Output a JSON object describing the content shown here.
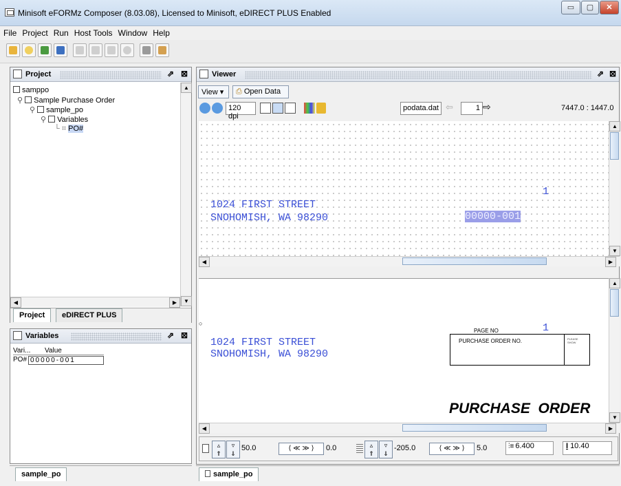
{
  "window": {
    "title": "Minisoft eFORMz Composer (8.03.08), Licensed to Minisoft, eDIRECT PLUS Enabled",
    "min_symbol": "▭",
    "max_symbol": "▢",
    "close_symbol": "✕"
  },
  "menu": [
    "File",
    "Project",
    "Run",
    "Host Tools",
    "Window",
    "Help"
  ],
  "project_panel": {
    "title": "Project",
    "tree": [
      {
        "label": "samppo",
        "icon": "printer-icon"
      },
      {
        "label": "Sample Purchase Order",
        "icon": "document-icon"
      },
      {
        "label": "sample_po",
        "icon": "form-icon"
      },
      {
        "label": "Variables",
        "icon": "variables-icon"
      },
      {
        "label": "PO#",
        "icon": "variable-icon"
      }
    ],
    "tabs": [
      "Project",
      "eDIRECT PLUS"
    ]
  },
  "variables_panel": {
    "title": "Variables",
    "headers": [
      "Vari...",
      "Value"
    ],
    "rows": [
      [
        "PO#",
        "00000-001"
      ]
    ]
  },
  "bottom_tabs": {
    "left": "sample_po",
    "right": "sample_po"
  },
  "viewer": {
    "title": "Viewer",
    "view_label": "View ▾",
    "open_data_label": "Open Data",
    "dpi": "120 dpi",
    "data_file": "podata.dat",
    "page_number": "1",
    "coordinates": "7447.0 : 1447.0",
    "top_text": {
      "line1": "1024 FIRST STREET",
      "line2": "SNOHOMISH, WA 98290",
      "page_num": "1",
      "po_value": "00000-001"
    },
    "bottom_text": {
      "line1": "1024 FIRST STREET",
      "line2": "SNOHOMISH, WA 98290",
      "page_no_label": "PAGE NO",
      "page_num": "1",
      "po_label": "PURCHASE ORDER NO.",
      "po_small": "PLEASE\nSHOW",
      "heading": "PURCHASE  ORDER"
    }
  },
  "statusbar": {
    "x_value": "50.0",
    "x_offset": "0.0",
    "y_value": "-205.0",
    "y_offset": "5.0",
    "line_spacing": "6.400",
    "font_size": "10.40"
  }
}
